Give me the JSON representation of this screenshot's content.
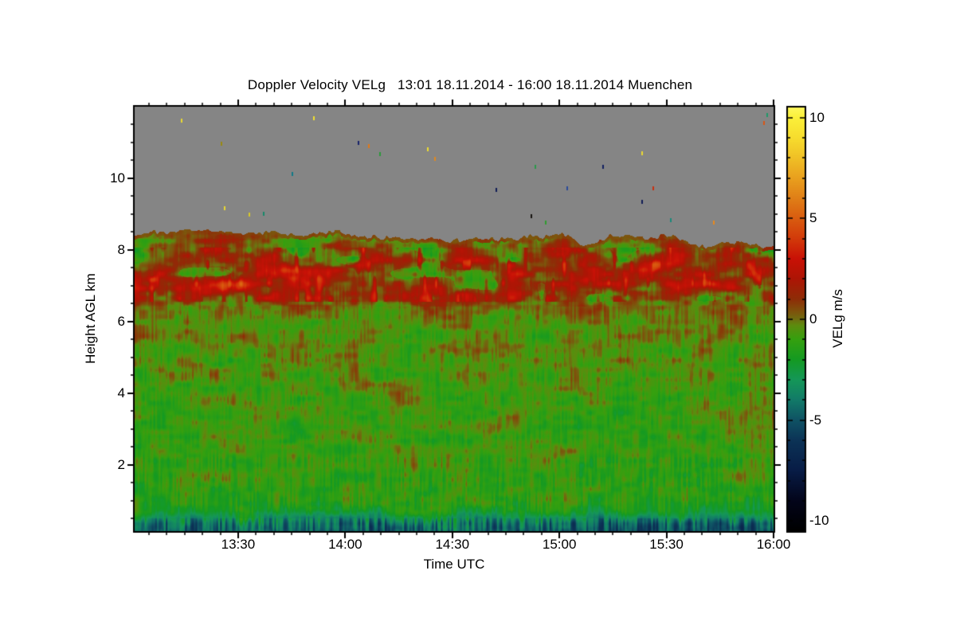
{
  "chart_data": {
    "type": "heatmap",
    "title": "Doppler Velocity VELg   13:01 18.11.2014 - 16:00 18.11.2014 Muenchen",
    "product": "Doppler Velocity VELg",
    "time_start": "13:01 18.11.2014",
    "time_end": "16:00 18.11.2014",
    "station": "Muenchen",
    "x_axis": {
      "label": "Time UTC",
      "start_min_after_1301": 0,
      "end_min_after_1301": 179,
      "major_ticks": [
        {
          "t_min": 29,
          "label": "13:30"
        },
        {
          "t_min": 59,
          "label": "14:00"
        },
        {
          "t_min": 89,
          "label": "14:30"
        },
        {
          "t_min": 119,
          "label": "15:00"
        },
        {
          "t_min": 149,
          "label": "15:30"
        },
        {
          "t_min": 179,
          "label": "16:00"
        }
      ],
      "minor_tick_every_min": 5,
      "minor_tick_offset_min": 4
    },
    "y_axis": {
      "label": "Height AGL km",
      "min_km": 0.155,
      "max_km": 12.0,
      "major_ticks": [
        {
          "km": 2,
          "label": "2"
        },
        {
          "km": 4,
          "label": "4"
        },
        {
          "km": 6,
          "label": "6"
        },
        {
          "km": 8,
          "label": "8"
        },
        {
          "km": 10,
          "label": "10"
        }
      ],
      "minor_tick_every_km": 0.5
    },
    "colorbar": {
      "label": "VELg m/s",
      "min": -10.5,
      "max": 10.5,
      "major_ticks": [
        {
          "v": 10,
          "label": "10"
        },
        {
          "v": 5,
          "label": "5"
        },
        {
          "v": 0,
          "label": "0"
        },
        {
          "v": -5,
          "label": "-5"
        },
        {
          "v": -10,
          "label": "-10"
        }
      ],
      "minor_tick_every": 1,
      "colormap_stops": [
        [
          -10.5,
          "#000000"
        ],
        [
          -9.0,
          "#03051a"
        ],
        [
          -7.5,
          "#081c46"
        ],
        [
          -6.0,
          "#0c3356"
        ],
        [
          -5.0,
          "#0f5264"
        ],
        [
          -4.0,
          "#127a68"
        ],
        [
          -3.0,
          "#159758"
        ],
        [
          -2.0,
          "#149a22"
        ],
        [
          -1.0,
          "#35a00f"
        ],
        [
          -0.3,
          "#5d8c0e"
        ],
        [
          0.0,
          "#6f6d11"
        ],
        [
          0.4,
          "#7e520c"
        ],
        [
          1.0,
          "#8e2d07"
        ],
        [
          2.0,
          "#ad1505"
        ],
        [
          3.0,
          "#c91106"
        ],
        [
          4.0,
          "#d23a0a"
        ],
        [
          5.0,
          "#d95c10"
        ],
        [
          6.0,
          "#e07f17"
        ],
        [
          7.0,
          "#e9a01e"
        ],
        [
          8.0,
          "#f0c026"
        ],
        [
          9.0,
          "#f7dd2e"
        ],
        [
          10.0,
          "#fbf03a"
        ],
        [
          10.5,
          "#fdf85c"
        ]
      ]
    },
    "no_data_color": "#858585",
    "no_data_region": "above cloud top (~8.0-8.6 km) up to 12 km",
    "grid": {
      "note": "approximate mean Doppler velocity in m/s estimated from the image; positive=red (downward), negative=green/blue",
      "times_min": [
        0,
        15,
        30,
        45,
        60,
        75,
        90,
        105,
        120,
        135,
        150,
        165,
        179
      ],
      "heights_km": [
        0.2,
        0.35,
        0.5,
        0.7,
        1.0,
        1.5,
        2,
        3,
        4,
        5,
        6,
        6.5,
        7,
        7.4,
        7.8,
        8.1,
        8.45
      ],
      "values_mps": [
        [
          -4.2,
          -4.5,
          -4.0,
          -4.6,
          -4.3,
          -4.8,
          -4.2,
          -4.6,
          -4.9,
          -5.2,
          -4.4,
          -5.0,
          -4.8
        ],
        [
          -3.9,
          -4.1,
          -3.7,
          -4.2,
          -4.0,
          -4.3,
          -3.9,
          -4.2,
          -4.4,
          -4.7,
          -4.1,
          -4.5,
          -4.4
        ],
        [
          -3.0,
          -3.2,
          -2.9,
          -3.3,
          -3.1,
          -3.2,
          -3.0,
          -3.3,
          -3.4,
          -3.5,
          -3.1,
          -3.4,
          -3.3
        ],
        [
          -1.8,
          -1.9,
          -1.7,
          -2.0,
          -1.8,
          -1.9,
          -1.8,
          -2.0,
          -1.9,
          -2.1,
          -1.8,
          -2.0,
          -1.9
        ],
        [
          -1.3,
          -1.1,
          -1.4,
          -1.2,
          -1.0,
          -1.3,
          -1.2,
          -1.4,
          -1.1,
          -1.3,
          -1.2,
          -1.0,
          -1.2
        ],
        [
          -1.1,
          -0.9,
          -1.2,
          -1.0,
          -1.1,
          -0.8,
          -1.0,
          -1.2,
          -0.9,
          -1.1,
          -1.0,
          -0.9,
          -1.1
        ],
        [
          -1.0,
          -0.8,
          -1.2,
          -0.9,
          -1.1,
          -0.7,
          -1.0,
          -1.2,
          -0.8,
          -1.0,
          -1.1,
          -0.9,
          -1.0
        ],
        [
          -0.9,
          -1.1,
          -0.6,
          -1.0,
          -0.8,
          -1.0,
          -0.9,
          -0.7,
          -1.1,
          -0.8,
          -0.9,
          -1.0,
          -0.8
        ],
        [
          -0.8,
          -0.5,
          -1.0,
          -0.7,
          -0.9,
          -0.6,
          -0.8,
          -1.0,
          -0.6,
          -0.9,
          -0.7,
          -0.8,
          -0.9
        ],
        [
          -0.6,
          -0.8,
          -0.4,
          -0.7,
          -0.5,
          -0.8,
          -0.6,
          -0.4,
          -0.7,
          -0.5,
          -0.8,
          -0.6,
          -0.5
        ],
        [
          -0.2,
          -0.5,
          0.1,
          -0.3,
          -0.4,
          0.0,
          -0.2,
          -0.5,
          -0.1,
          -0.3,
          0.0,
          -0.4,
          -0.2
        ],
        [
          0.3,
          0.0,
          0.5,
          0.2,
          -0.1,
          0.4,
          0.1,
          0.3,
          0.0,
          0.5,
          0.2,
          0.1,
          0.3
        ],
        [
          1.6,
          1.3,
          1.9,
          0.9,
          1.1,
          1.5,
          1.0,
          1.3,
          1.7,
          0.9,
          1.4,
          1.1,
          1.0
        ],
        [
          1.3,
          1.7,
          1.1,
          1.3,
          0.8,
          1.2,
          1.4,
          0.9,
          1.3,
          1.0,
          1.5,
          1.2,
          0.9
        ],
        [
          0.5,
          0.8,
          0.4,
          0.7,
          0.3,
          0.6,
          0.9,
          0.5,
          0.7,
          0.4,
          0.8,
          0.6,
          0.5
        ],
        [
          0.5,
          0.3,
          0.6,
          0.2,
          0.4,
          0.3,
          0.5,
          0.2,
          0.4,
          0.5,
          0.3,
          0.4,
          0.3
        ],
        [
          0.2,
          0.4,
          0.1,
          0.3,
          0.2,
          0.4,
          0.1,
          0.3,
          0.2,
          0.1,
          0.3,
          0.2,
          0.2
        ]
      ]
    },
    "cloud_top_km": {
      "times_min_every": 5,
      "values": [
        8.44,
        8.5,
        8.47,
        8.54,
        8.58,
        8.5,
        8.45,
        8.5,
        8.44,
        8.4,
        8.44,
        8.5,
        8.42,
        8.38,
        8.34,
        8.3,
        8.34,
        8.28,
        8.24,
        8.3,
        8.34,
        8.28,
        8.36,
        8.32,
        8.42,
        8.1,
        8.28,
        8.42,
        8.36,
        8.3,
        8.38,
        8.22,
        8.02,
        8.18,
        8.22,
        8.05,
        8.12
      ]
    },
    "noise_speckles": [
      [
        13,
        11.6,
        "#e8d832"
      ],
      [
        24,
        10.95,
        "#9a8a10"
      ],
      [
        25,
        9.15,
        "#e8d832"
      ],
      [
        32,
        8.97,
        "#d8c828"
      ],
      [
        36,
        9.0,
        "#178a6a"
      ],
      [
        44,
        10.1,
        "#0f7a88"
      ],
      [
        50,
        11.66,
        "#f0e030"
      ],
      [
        62.5,
        10.97,
        "#16226a"
      ],
      [
        65.4,
        10.88,
        "#e07818"
      ],
      [
        68.5,
        10.66,
        "#2a9a3a"
      ],
      [
        82,
        10.79,
        "#eede30"
      ],
      [
        84,
        10.53,
        "#e08820"
      ],
      [
        101,
        9.66,
        "#101c55"
      ],
      [
        111,
        8.93,
        "#15130f"
      ],
      [
        112,
        10.3,
        "#2a9a4a"
      ],
      [
        115,
        8.75,
        "#2f9e2f"
      ],
      [
        121,
        9.7,
        "#2a4a9a"
      ],
      [
        131,
        10.3,
        "#121f60"
      ],
      [
        142,
        10.68,
        "#ead832"
      ],
      [
        145,
        9.7,
        "#c83010"
      ],
      [
        142,
        9.33,
        "#101c55"
      ],
      [
        150,
        8.82,
        "#1a8a7a"
      ],
      [
        162,
        8.75,
        "#e8881c"
      ],
      [
        176,
        11.53,
        "#d85515"
      ],
      [
        177,
        11.75,
        "#1d9a68"
      ]
    ]
  }
}
